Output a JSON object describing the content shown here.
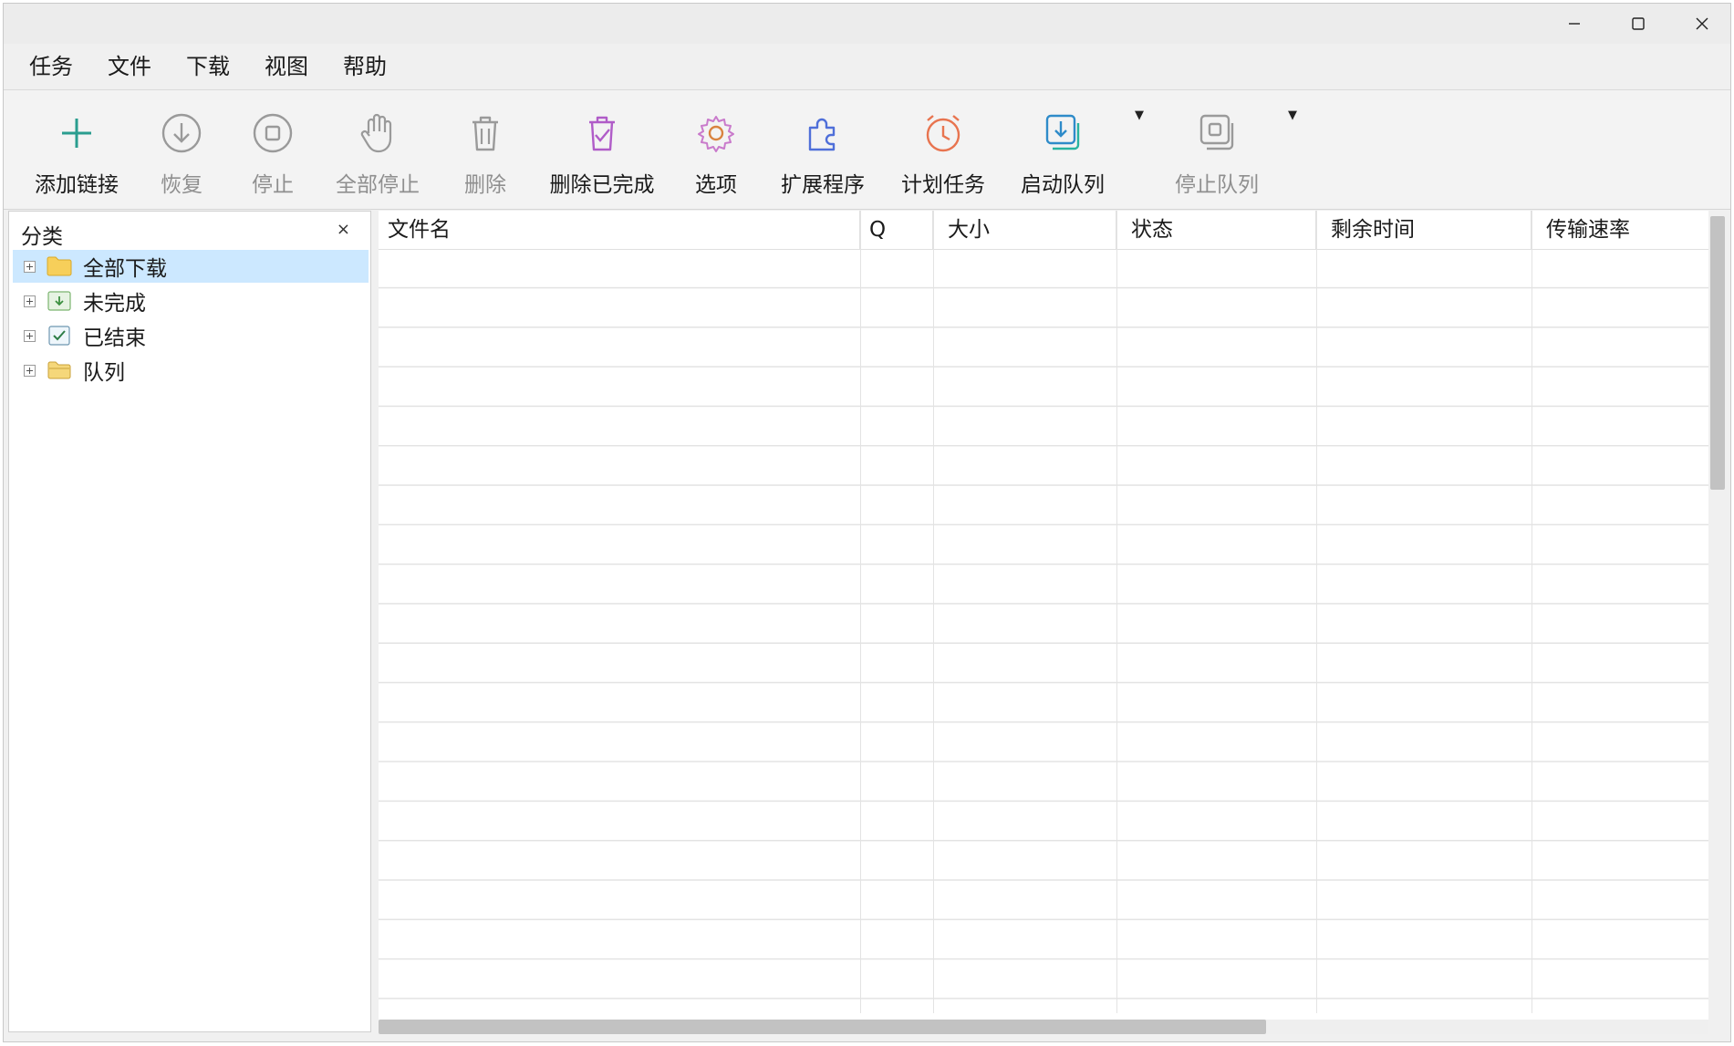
{
  "window": {
    "controls": {
      "minimize_icon": "minimize-icon",
      "maximize_icon": "maximize-icon",
      "close_icon": "close-icon"
    }
  },
  "menubar": {
    "items": [
      {
        "label": "任务"
      },
      {
        "label": "文件"
      },
      {
        "label": "下载"
      },
      {
        "label": "视图"
      },
      {
        "label": "帮助"
      }
    ]
  },
  "toolbar": {
    "buttons": [
      {
        "label": "添加链接",
        "icon": "plus-icon",
        "enabled": true,
        "color": "#2a9d8f"
      },
      {
        "label": "恢复",
        "icon": "resume-download-icon",
        "enabled": false,
        "color": "#9a9a9a"
      },
      {
        "label": "停止",
        "icon": "stop-icon",
        "enabled": false,
        "color": "#9a9a9a"
      },
      {
        "label": "全部停止",
        "icon": "hand-stop-icon",
        "enabled": false,
        "color": "#9a9a9a"
      },
      {
        "label": "删除",
        "icon": "trash-icon",
        "enabled": false,
        "color": "#9a9a9a"
      },
      {
        "label": "删除已完成",
        "icon": "trash-check-icon",
        "enabled": true,
        "color": "#b05cc8"
      },
      {
        "label": "选项",
        "icon": "gear-icon",
        "enabled": true,
        "color": "#d9833f"
      },
      {
        "label": "扩展程序",
        "icon": "puzzle-icon",
        "enabled": true,
        "color": "#4f6fd9"
      },
      {
        "label": "计划任务",
        "icon": "alarm-clock-icon",
        "enabled": true,
        "color": "#e8744f"
      },
      {
        "label": "启动队列",
        "icon": "start-queue-icon",
        "enabled": true,
        "color": "#2e8bc9"
      },
      {
        "label": "停止队列",
        "icon": "stop-queue-icon",
        "enabled": false,
        "color": "#9a9a9a"
      }
    ]
  },
  "sidebar": {
    "title": "分类",
    "close_glyph": "×",
    "items": [
      {
        "label": "全部下载",
        "icon": "folder-icon",
        "selected": true
      },
      {
        "label": "未完成",
        "icon": "incomplete-download-icon",
        "selected": false
      },
      {
        "label": "已结束",
        "icon": "checkbox-checked-icon",
        "selected": false
      },
      {
        "label": "队列",
        "icon": "queue-folder-icon",
        "selected": false
      }
    ]
  },
  "grid": {
    "columns": [
      "文件名",
      "Q",
      "大小",
      "状态",
      "剩余时间",
      "传输速率"
    ],
    "rows": []
  },
  "colors": {
    "selection": "#cce8ff",
    "accent_add": "#2a9d8f",
    "disabled": "#9a9a9a"
  }
}
